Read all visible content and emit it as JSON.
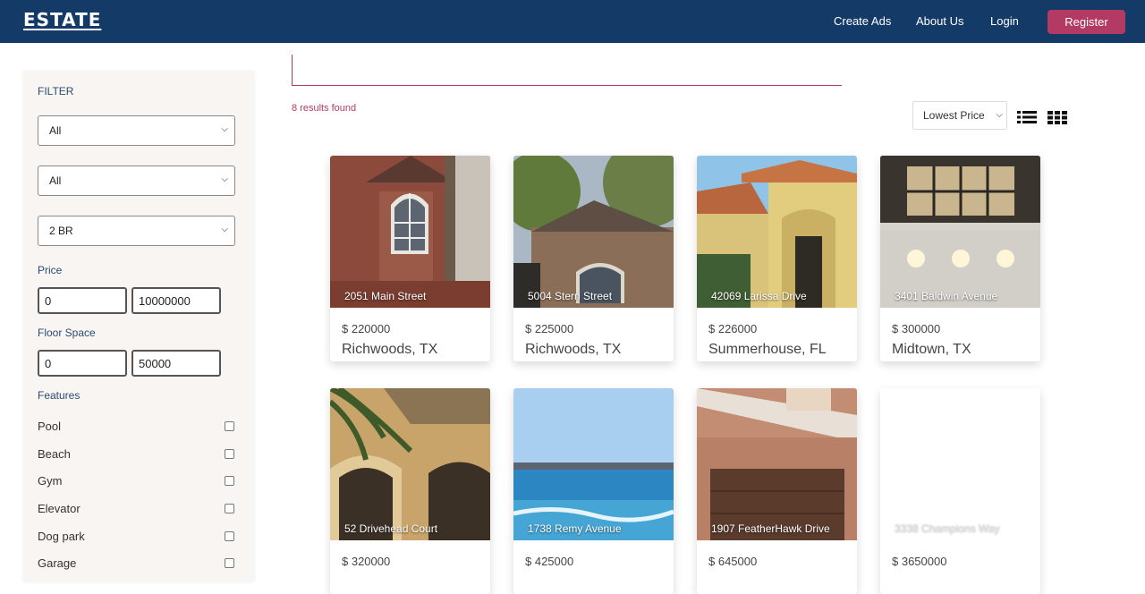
{
  "nav": {
    "logo": "ESTATE",
    "create_ads": "Create Ads",
    "about_us": "About Us",
    "login": "Login",
    "register": "Register"
  },
  "filter": {
    "title": "FILTER",
    "select1": "All",
    "select2": "All",
    "select3": "2 BR",
    "price_label": "Price",
    "price_min": "0",
    "price_max": "10000000",
    "floor_label": "Floor Space",
    "floor_min": "0",
    "floor_max": "50000",
    "features_label": "Features",
    "features": [
      {
        "label": "Pool",
        "checked": false
      },
      {
        "label": "Beach",
        "checked": false
      },
      {
        "label": "Gym",
        "checked": false
      },
      {
        "label": "Elevator",
        "checked": false
      },
      {
        "label": "Dog park",
        "checked": false
      },
      {
        "label": "Garage",
        "checked": false
      }
    ]
  },
  "results": {
    "count_text": "8 results found",
    "sort_value": "Lowest Price"
  },
  "listings": [
    {
      "address": "2051 Main Street",
      "price": "$ 220000",
      "city": "Richwoods, TX"
    },
    {
      "address": "5004 Stern Street",
      "price": "$ 225000",
      "city": "Richwoods, TX"
    },
    {
      "address": "42069 Larissa Drive",
      "price": "$ 226000",
      "city": "Summerhouse, FL"
    },
    {
      "address": "3401 Baldwin Avenue",
      "price": "$ 300000",
      "city": "Midtown, TX"
    },
    {
      "address": "52 Drivehead Court",
      "price": "$ 320000",
      "city": ""
    },
    {
      "address": "1738 Remy Avenue",
      "price": "$ 425000",
      "city": ""
    },
    {
      "address": "1907 FeatherHawk Drive",
      "price": "$ 645000",
      "city": ""
    },
    {
      "address": "3338 Champions Way",
      "price": "$ 3650000",
      "city": ""
    }
  ],
  "colors": {
    "navbar": "#143a68",
    "accent": "#b33b63",
    "sidebar_bg": "#f8f5f3"
  }
}
